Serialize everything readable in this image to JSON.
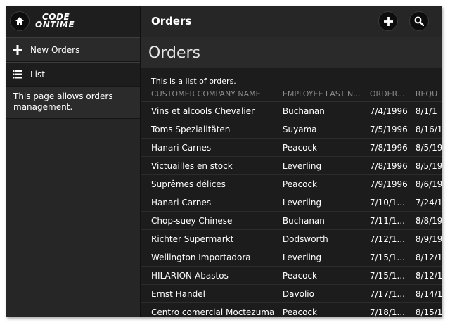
{
  "app": {
    "logo_line1": "CODE",
    "logo_line2": "ONTIME",
    "header_title": "Orders"
  },
  "sidebar": {
    "items": [
      {
        "label": "New Orders",
        "icon": "plus-icon"
      },
      {
        "label": "List",
        "icon": "list-icon"
      }
    ],
    "description": "This page allows orders management."
  },
  "page": {
    "title": "Orders",
    "description": "This is a list of orders."
  },
  "table": {
    "headers": [
      "CUSTOMER COMPANY NAME",
      "EMPLOYEE LAST N...",
      "ORDER...",
      "REQU"
    ],
    "rows": [
      [
        "Vins et alcools Chevalier",
        "Buchanan",
        "7/4/1996",
        "8/1/1"
      ],
      [
        "Toms Spezialitäten",
        "Suyama",
        "7/5/1996",
        "8/16/1"
      ],
      [
        "Hanari Carnes",
        "Peacock",
        "7/8/1996",
        "8/5/19"
      ],
      [
        "Victuailles en stock",
        "Leverling",
        "7/8/1996",
        "8/5/19"
      ],
      [
        "Suprêmes délices",
        "Peacock",
        "7/9/1996",
        "8/6/19"
      ],
      [
        "Hanari Carnes",
        "Leverling",
        "7/10/1...",
        "7/24/1"
      ],
      [
        "Chop-suey Chinese",
        "Buchanan",
        "7/11/1...",
        "8/8/19"
      ],
      [
        "Richter Supermarkt",
        "Dodsworth",
        "7/12/1...",
        "8/9/19"
      ],
      [
        "Wellington Importadora",
        "Leverling",
        "7/15/1...",
        "8/12/1"
      ],
      [
        "HILARION-Abastos",
        "Peacock",
        "7/15/1...",
        "8/12/1"
      ],
      [
        "Ernst Handel",
        "Davolio",
        "7/17/1...",
        "8/14/1"
      ],
      [
        "Centro comercial Moctezuma",
        "Peacock",
        "7/18/1...",
        "8/15/1"
      ]
    ]
  },
  "colors": {
    "background": "#1e1e1e",
    "sidebar": "#262626",
    "text": "#ffffff",
    "header_text_muted": "#8a8a8a"
  }
}
